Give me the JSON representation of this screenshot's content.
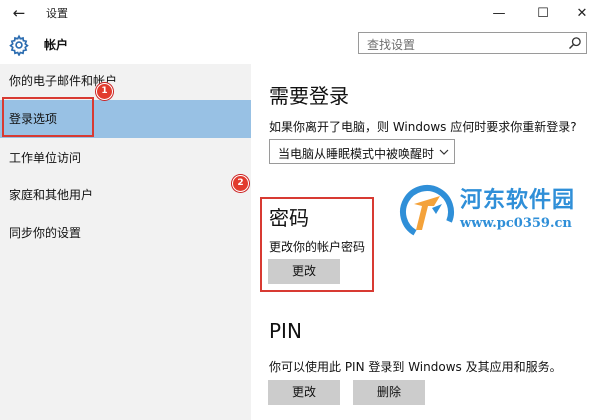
{
  "window": {
    "title": "设置",
    "back_glyph": "←",
    "minimize_glyph": "—",
    "maximize_glyph": "☐",
    "close_glyph": "✕"
  },
  "header": {
    "title": "帐户",
    "search_placeholder": "查找设置",
    "icon": "gear-icon"
  },
  "sidebar": {
    "items": [
      {
        "label": "你的电子邮件和帐户",
        "active": false
      },
      {
        "label": "登录选项",
        "active": true
      },
      {
        "label": "工作单位访问",
        "active": false
      },
      {
        "label": "家庭和其他用户",
        "active": false
      },
      {
        "label": "同步你的设置",
        "active": false
      }
    ]
  },
  "annotations": {
    "badge_1": "1",
    "badge_2": "2",
    "color": "#d83a32"
  },
  "main": {
    "require_login": {
      "heading": "需要登录",
      "description": "如果你离开了电脑，则 Windows 应何时要求你重新登录?",
      "dropdown_value": "当电脑从睡眠模式中被唤醒时"
    },
    "password": {
      "heading": "密码",
      "description": "更改你的帐户密码",
      "change_label": "更改"
    },
    "pin": {
      "heading": "PIN",
      "description": "你可以使用此 PIN 登录到 Windows 及其应用和服务。",
      "change_label": "更改",
      "delete_label": "删除"
    }
  },
  "watermark": {
    "name": "河东软件园",
    "url": "www.pc0359.cn"
  },
  "colors": {
    "accent_selected": "#98c1e4",
    "sidebar_bg": "#f2f2f2",
    "button_bg": "#cccccc",
    "watermark": "#2f8fd8"
  }
}
